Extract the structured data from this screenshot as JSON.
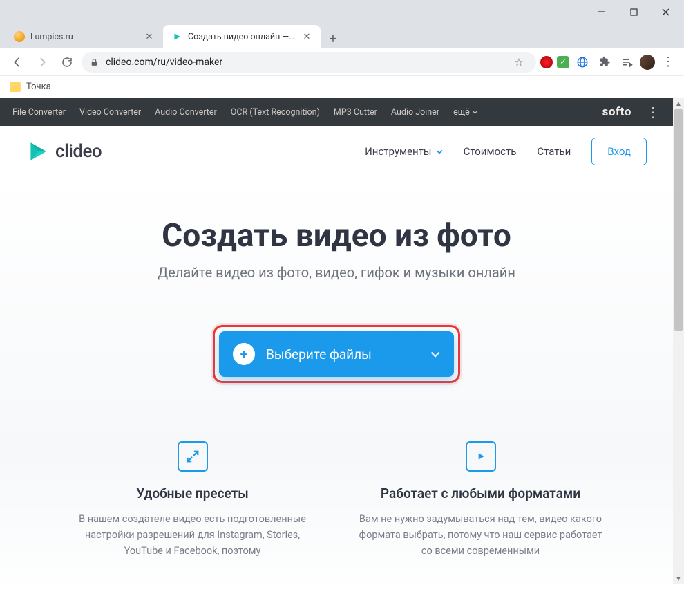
{
  "window": {
    "tabs": [
      {
        "title": "Lumpics.ru"
      },
      {
        "title": "Создать видео онлайн — Сдела"
      }
    ],
    "url": "clideo.com/ru/video-maker"
  },
  "bookmarks": {
    "item1": "Точка"
  },
  "utility_bar": {
    "items": [
      "File Converter",
      "Video Converter",
      "Audio Converter",
      "OCR (Text Recognition)",
      "MP3 Cutter",
      "Audio Joiner"
    ],
    "more": "ещё",
    "brand": "softo"
  },
  "site": {
    "logo_text": "clideo",
    "nav": {
      "tools": "Инструменты",
      "pricing": "Стоимость",
      "articles": "Статьи",
      "login": "Вход"
    }
  },
  "hero": {
    "title": "Создать видео из фото",
    "subtitle": "Делайте видео из фото, видео, гифок и музыки онлайн",
    "upload_label": "Выберите файлы"
  },
  "features": [
    {
      "title": "Удобные пресеты",
      "desc": "В нашем создателе видео есть подготовленные настройки разрешений для Instagram, Stories, YouTube и Facebook, поэтому"
    },
    {
      "title": "Работает с любыми форматами",
      "desc": "Вам не нужно задумываться над тем, видео какого формата выбрать, потому что наш сервис работает со всеми современными"
    }
  ]
}
